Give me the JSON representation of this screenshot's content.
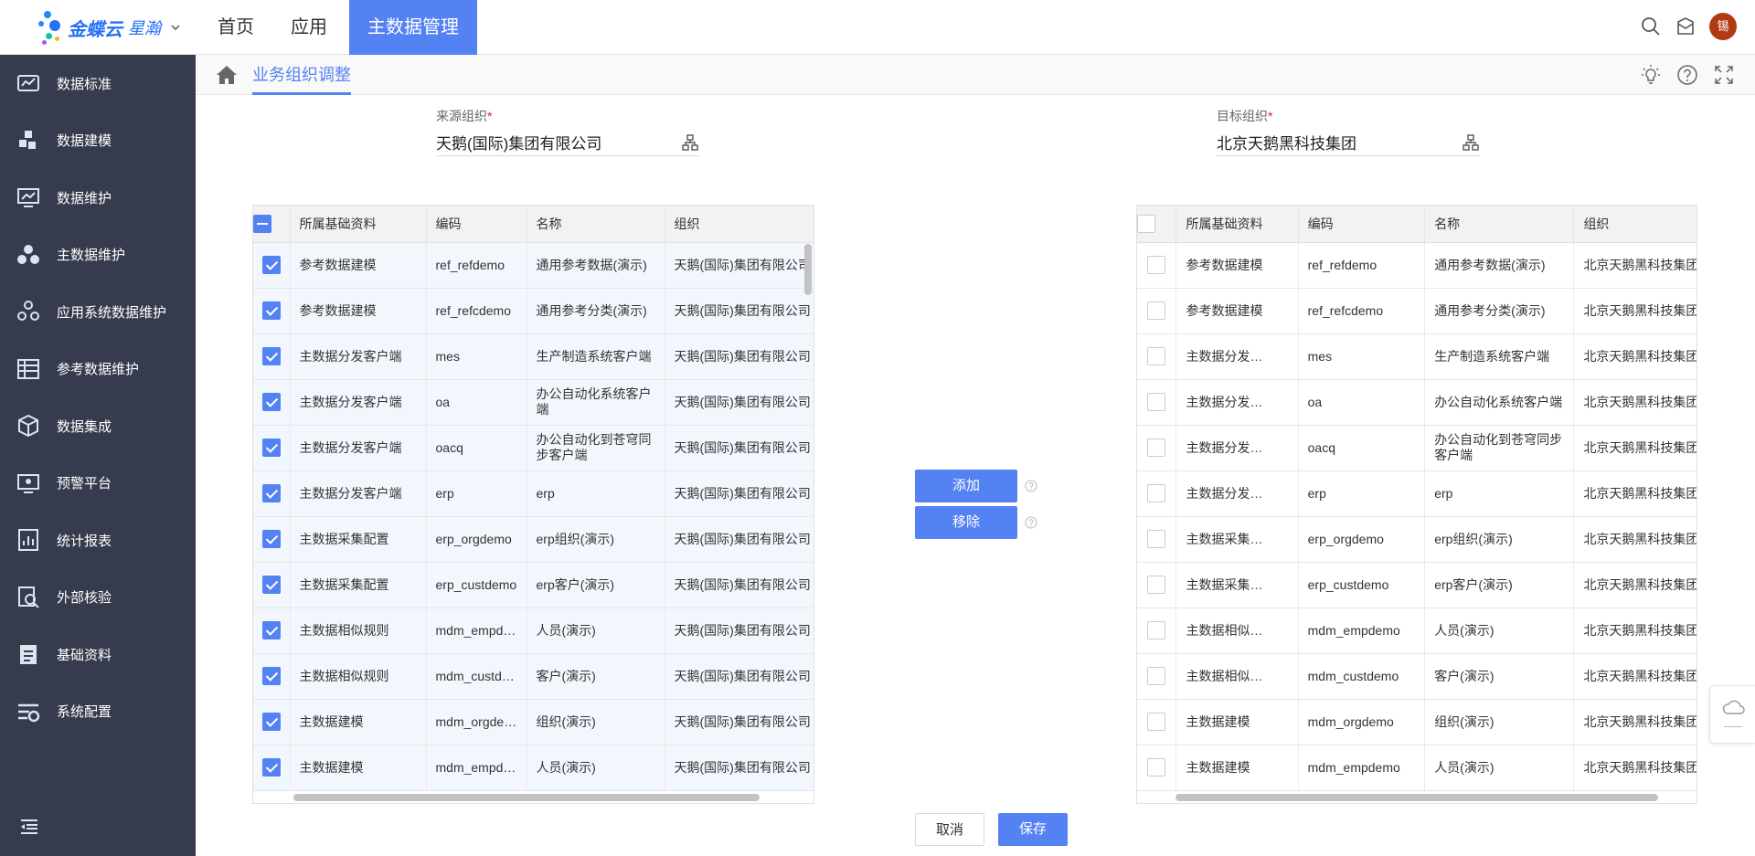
{
  "app": {
    "logo_text": "金蝶云",
    "logo_sub": "星瀚",
    "nav": [
      "首页",
      "应用",
      "主数据管理"
    ],
    "avatar": "锡"
  },
  "sidebar": {
    "items": [
      {
        "label": "数据标准",
        "icon": "data-standard-icon"
      },
      {
        "label": "数据建模",
        "icon": "data-modeling-icon"
      },
      {
        "label": "数据维护",
        "icon": "data-maintenance-icon"
      },
      {
        "label": "主数据维护",
        "icon": "master-data-icon"
      },
      {
        "label": "应用系统数据维护",
        "icon": "app-system-icon"
      },
      {
        "label": "参考数据维护",
        "icon": "reference-data-icon"
      },
      {
        "label": "数据集成",
        "icon": "data-integration-icon"
      },
      {
        "label": "预警平台",
        "icon": "alert-platform-icon"
      },
      {
        "label": "统计报表",
        "icon": "report-icon"
      },
      {
        "label": "外部核验",
        "icon": "external-verify-icon"
      },
      {
        "label": "基础资料",
        "icon": "base-data-icon"
      },
      {
        "label": "系统配置",
        "icon": "system-config-icon"
      }
    ]
  },
  "breadcrumb": {
    "label": "业务组织调整"
  },
  "source": {
    "label": "来源组织",
    "required": "*",
    "value": "天鹅(国际)集团有限公司"
  },
  "target": {
    "label": "目标组织",
    "required": "*",
    "value": "北京天鹅黑科技集团"
  },
  "columns": [
    "所属基础资料",
    "编码",
    "名称",
    "组织"
  ],
  "left_rows": [
    [
      "参考数据建模",
      "ref_refdemo",
      "通用参考数据(演示)",
      "天鹅(国际)集团有限公司"
    ],
    [
      "参考数据建模",
      "ref_refcdemo",
      "通用参考分类(演示)",
      "天鹅(国际)集团有限公司"
    ],
    [
      "主数据分发客户端",
      "mes",
      "生产制造系统客户端",
      "天鹅(国际)集团有限公司"
    ],
    [
      "主数据分发客户端",
      "oa",
      "办公自动化系统客户端",
      "天鹅(国际)集团有限公司"
    ],
    [
      "主数据分发客户端",
      "oacq",
      "办公自动化到苍穹同步客户端",
      "天鹅(国际)集团有限公司"
    ],
    [
      "主数据分发客户端",
      "erp",
      "erp",
      "天鹅(国际)集团有限公司"
    ],
    [
      "主数据采集配置",
      "erp_orgdemo",
      "erp组织(演示)",
      "天鹅(国际)集团有限公司"
    ],
    [
      "主数据采集配置",
      "erp_custdemo",
      "erp客户(演示)",
      "天鹅(国际)集团有限公司"
    ],
    [
      "主数据相似规则",
      "mdm_empdemo",
      "人员(演示)",
      "天鹅(国际)集团有限公司"
    ],
    [
      "主数据相似规则",
      "mdm_custdemo",
      "客户(演示)",
      "天鹅(国际)集团有限公司"
    ],
    [
      "主数据建模",
      "mdm_orgdemo",
      "组织(演示)",
      "天鹅(国际)集团有限公司"
    ],
    [
      "主数据建模",
      "mdm_empdemo",
      "人员(演示)",
      "天鹅(国际)集团有限公司"
    ]
  ],
  "right_rows": [
    [
      "参考数据建模",
      "ref_refdemo",
      "通用参考数据(演示)",
      "北京天鹅黑科技集团"
    ],
    [
      "参考数据建模",
      "ref_refcdemo",
      "通用参考分类(演示)",
      "北京天鹅黑科技集团"
    ],
    [
      "主数据分发…",
      "mes",
      "生产制造系统客户端",
      "北京天鹅黑科技集团"
    ],
    [
      "主数据分发…",
      "oa",
      "办公自动化系统客户端",
      "北京天鹅黑科技集团"
    ],
    [
      "主数据分发…",
      "oacq",
      "办公自动化到苍穹同步客户端",
      "北京天鹅黑科技集团"
    ],
    [
      "主数据分发…",
      "erp",
      "erp",
      "北京天鹅黑科技集团"
    ],
    [
      "主数据采集…",
      "erp_orgdemo",
      "erp组织(演示)",
      "北京天鹅黑科技集团"
    ],
    [
      "主数据采集…",
      "erp_custdemo",
      "erp客户(演示)",
      "北京天鹅黑科技集团"
    ],
    [
      "主数据相似…",
      "mdm_empdemo",
      "人员(演示)",
      "北京天鹅黑科技集团"
    ],
    [
      "主数据相似…",
      "mdm_custdemo",
      "客户(演示)",
      "北京天鹅黑科技集团"
    ],
    [
      "主数据建模",
      "mdm_orgdemo",
      "组织(演示)",
      "北京天鹅黑科技集团"
    ],
    [
      "主数据建模",
      "mdm_empdemo",
      "人员(演示)",
      "北京天鹅黑科技集团"
    ]
  ],
  "actions": {
    "add": "添加",
    "remove": "移除",
    "cancel": "取消",
    "save": "保存"
  },
  "colors": {
    "accent": "#5582f3",
    "sidebar_bg": "#363b4d",
    "avatar_bg": "#b23a12"
  }
}
